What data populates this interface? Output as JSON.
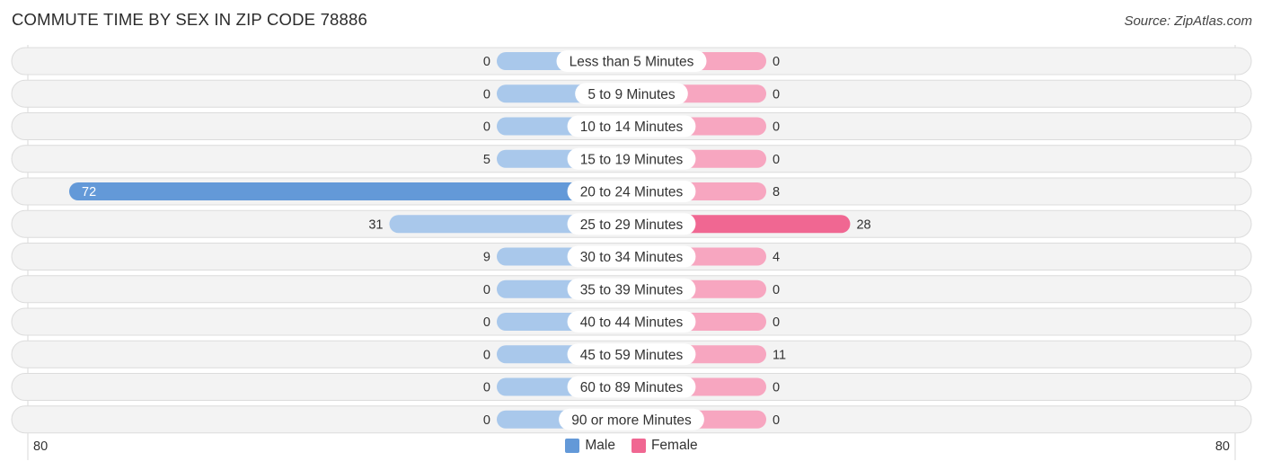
{
  "header": {
    "title": "COMMUTE TIME BY SEX IN ZIP CODE 78886",
    "source": "Source: ZipAtlas.com"
  },
  "colors": {
    "male_strong": "#6399d8",
    "male_light": "#a9c8eb",
    "female_strong": "#f06792",
    "female_light": "#f7a6c0",
    "row_bg": "#f3f3f3",
    "row_border": "#dcdcdc"
  },
  "chart_data": {
    "type": "bar",
    "title": "COMMUTE TIME BY SEX IN ZIP CODE 78886",
    "orientation": "horizontal-diverging",
    "categories": [
      "Less than 5 Minutes",
      "5 to 9 Minutes",
      "10 to 14 Minutes",
      "15 to 19 Minutes",
      "20 to 24 Minutes",
      "25 to 29 Minutes",
      "30 to 34 Minutes",
      "35 to 39 Minutes",
      "40 to 44 Minutes",
      "45 to 59 Minutes",
      "60 to 89 Minutes",
      "90 or more Minutes"
    ],
    "series": [
      {
        "name": "Male",
        "side": "left",
        "values": [
          0,
          0,
          0,
          5,
          72,
          31,
          9,
          0,
          0,
          0,
          0,
          0
        ]
      },
      {
        "name": "Female",
        "side": "right",
        "values": [
          0,
          0,
          0,
          0,
          8,
          28,
          4,
          0,
          0,
          11,
          0,
          0
        ]
      }
    ],
    "axis": {
      "left_max_label": "80",
      "right_max_label": "80",
      "range": [
        80,
        80
      ]
    },
    "legend": {
      "position": "bottom-center",
      "entries": [
        "Male",
        "Female"
      ]
    },
    "xlabel": "",
    "ylabel": ""
  }
}
